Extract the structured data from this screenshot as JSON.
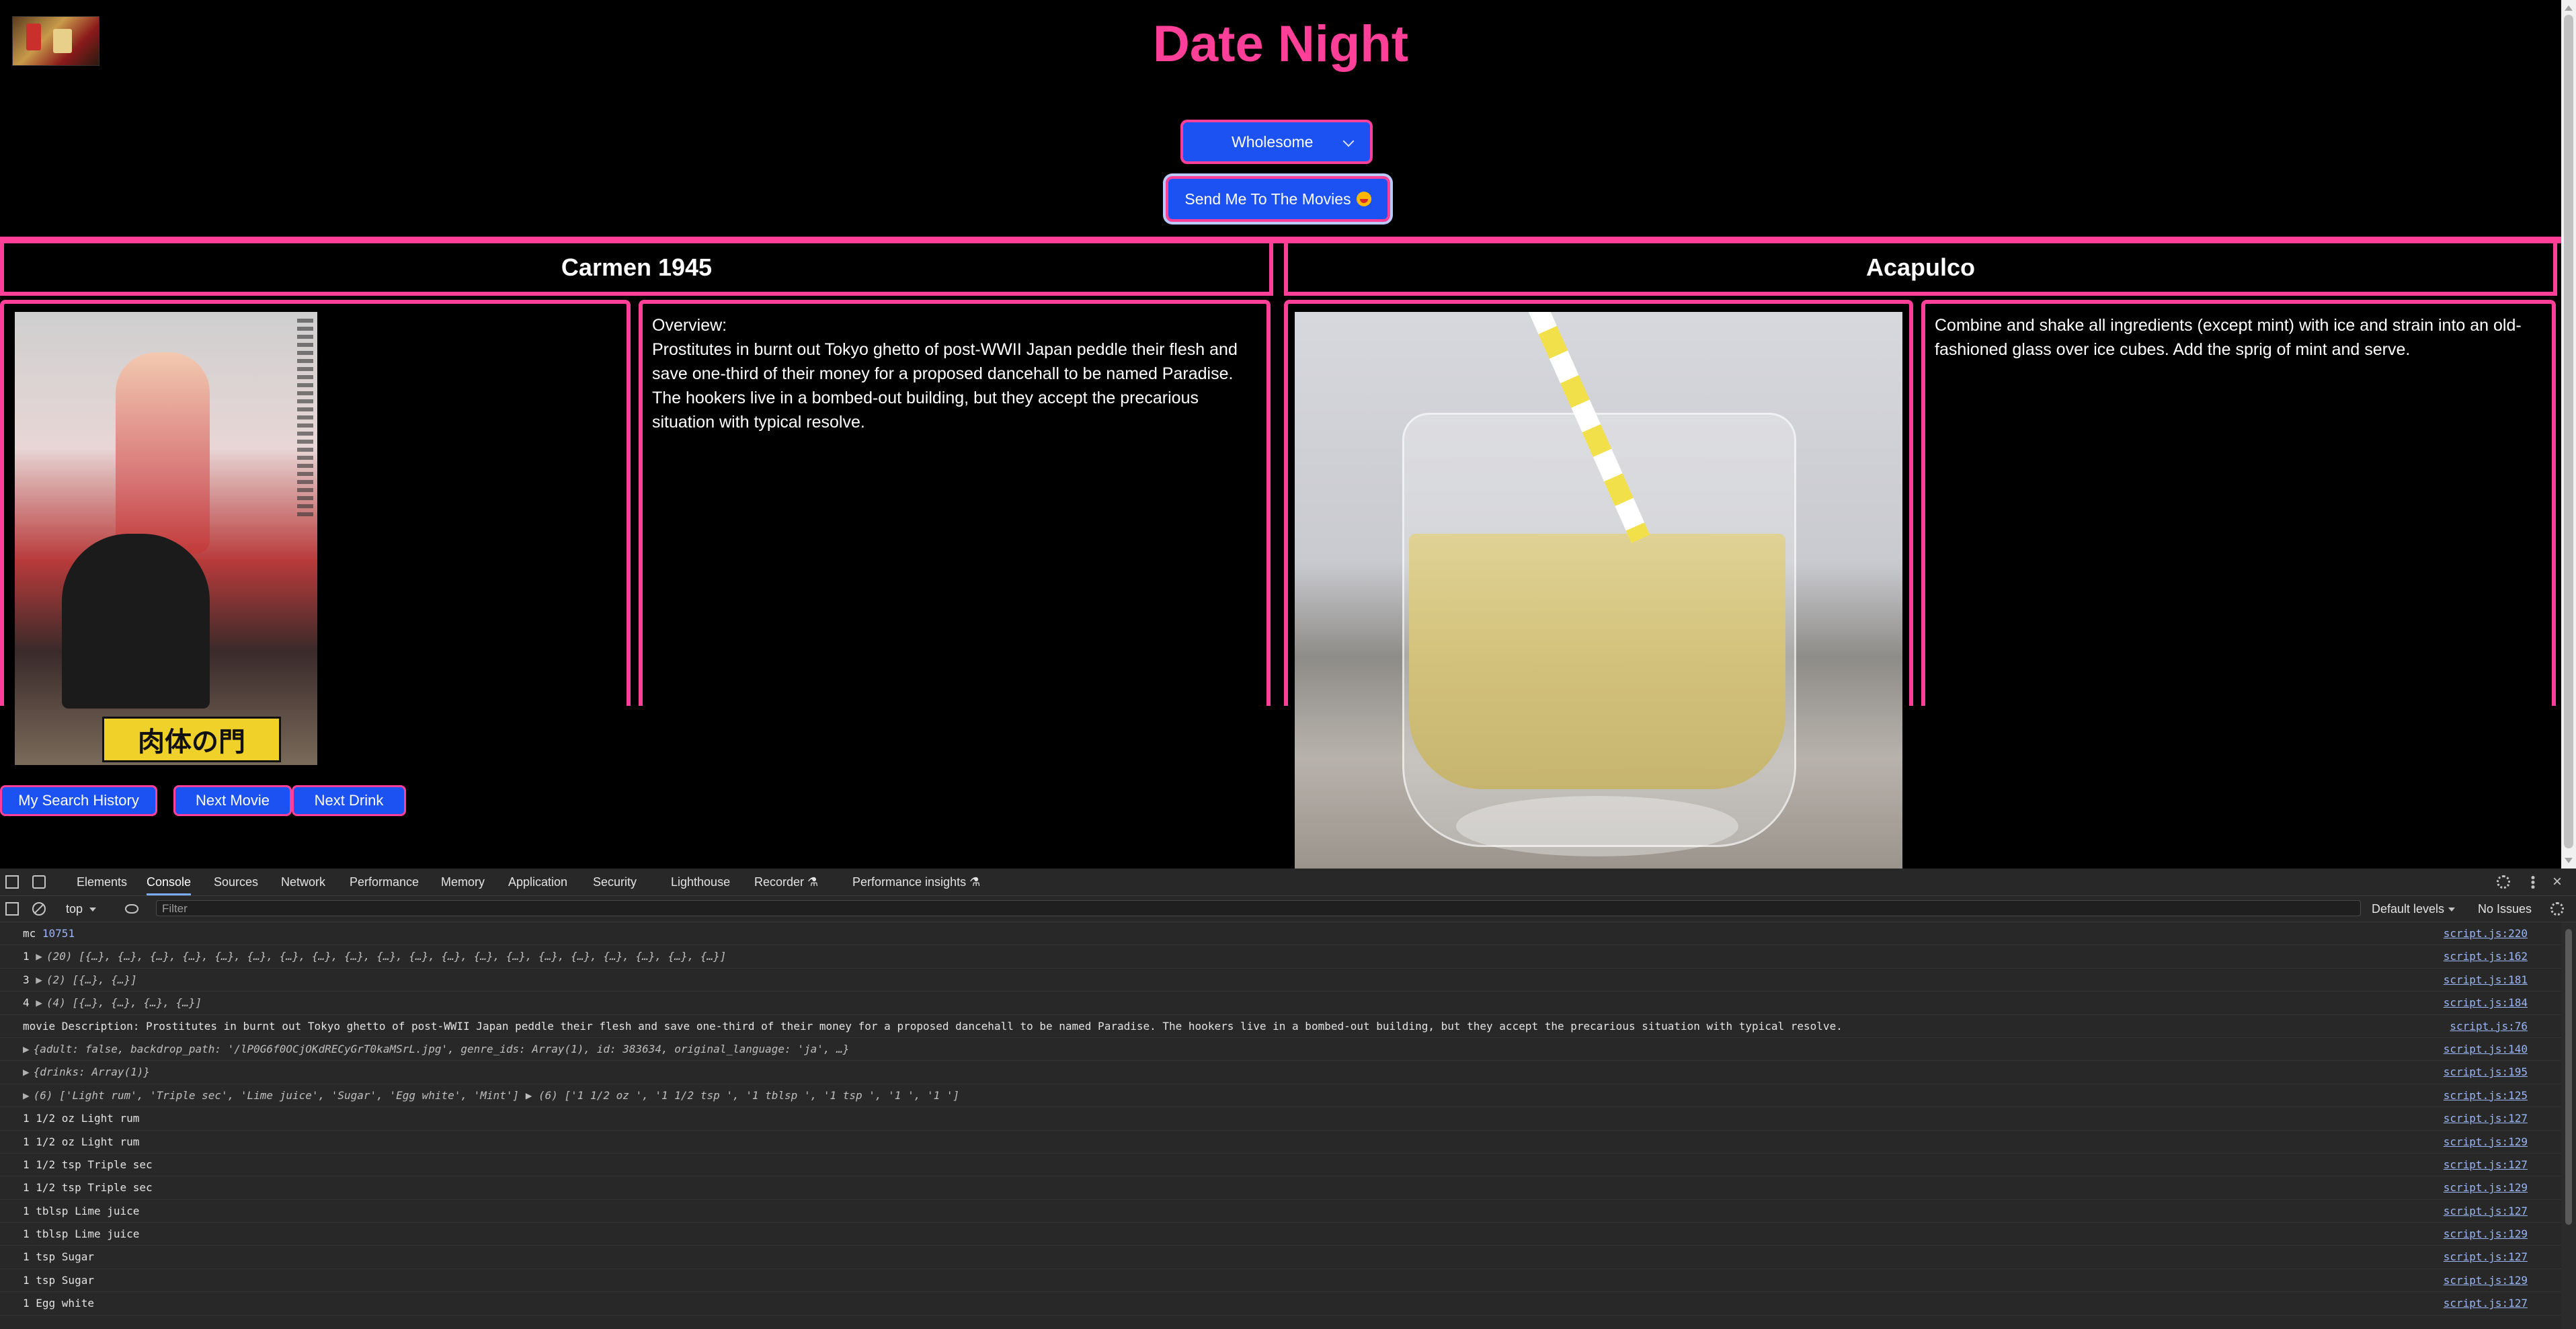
{
  "page": {
    "title": "Date Night",
    "mood_select": "Wholesome",
    "send_button": "Send Me To The Movies",
    "movie": {
      "title": "Carmen 1945",
      "overview_label": "Overview:",
      "overview": "Prostitutes in burnt out Tokyo ghetto of post-WWII Japan peddle their flesh and save one-third of their money for a proposed dancehall to be named Paradise. The hookers live in a bombed-out building, but they accept the precarious situation with typical resolve.",
      "poster_text": "肉体の門"
    },
    "drink": {
      "title": "Acapulco",
      "instructions": "Combine and shake all ingredients (except mint) with ice and strain into an old-fashioned glass over ice cubes. Add the sprig of mint and serve."
    },
    "buttons": {
      "history": "My Search History",
      "next_movie": "Next Movie",
      "next_drink": "Next Drink"
    }
  },
  "devtools": {
    "tabs": [
      "Elements",
      "Console",
      "Sources",
      "Network",
      "Performance",
      "Memory",
      "Application",
      "Security",
      "Lighthouse",
      "Recorder ⚗",
      "Performance insights ⚗"
    ],
    "active_tab": "Console",
    "context": "top",
    "filter_placeholder": "Filter",
    "levels": "Default levels",
    "issues": "No Issues",
    "logs": [
      {
        "prefix": "mc",
        "text": "10751",
        "source": "script.js:220"
      },
      {
        "prefix": "1",
        "text": "(20) [{…}, {…}, {…}, {…}, {…}, {…}, {…}, {…}, {…}, {…}, {…}, {…}, {…}, {…}, {…}, {…}, {…}, {…}, {…}, {…}]",
        "source": "script.js:162"
      },
      {
        "prefix": "3",
        "text": "(2) [{…}, {…}]",
        "source": "script.js:181"
      },
      {
        "prefix": "4",
        "text": "(4) [{…}, {…}, {…}, {…}]",
        "source": "script.js:184"
      },
      {
        "prefix": "movie Description:",
        "text": "Prostitutes in burnt out Tokyo ghetto of post-WWII Japan peddle their flesh and save one-third of their money for a proposed dancehall to be named Paradise. The hookers live in a bombed-out building, but they accept the precarious situation with typical resolve.",
        "source": "script.js:76"
      },
      {
        "prefix": "",
        "text": "{adult: false, backdrop_path: '/lP0G6f0OCjOKdRECyGrT0kaMSrL.jpg', genre_ids: Array(1), id: 383634, original_language: 'ja', …}",
        "source": "script.js:140"
      },
      {
        "prefix": "",
        "text": "{drinks: Array(1)}",
        "source": "script.js:195"
      },
      {
        "prefix": "",
        "text": "(6) ['Light rum', 'Triple sec', 'Lime juice', 'Sugar', 'Egg white', 'Mint'] ▶ (6) ['1 1/2 oz ', '1 1/2 tsp ', '1 tblsp ', '1 tsp ', '1 ', '1 ']",
        "source": "script.js:125"
      },
      {
        "prefix": "",
        "text": "1 1/2 oz  Light rum",
        "source": "script.js:127"
      },
      {
        "prefix": "",
        "text": "1 1/2 oz  Light rum",
        "source": "script.js:129"
      },
      {
        "prefix": "",
        "text": "1 1/2 tsp  Triple sec",
        "source": "script.js:127"
      },
      {
        "prefix": "",
        "text": "1 1/2 tsp  Triple sec",
        "source": "script.js:129"
      },
      {
        "prefix": "",
        "text": "1 tblsp  Lime juice",
        "source": "script.js:127"
      },
      {
        "prefix": "",
        "text": "1 tblsp  Lime juice",
        "source": "script.js:129"
      },
      {
        "prefix": "",
        "text": "1 tsp  Sugar",
        "source": "script.js:127"
      },
      {
        "prefix": "",
        "text": "1 tsp  Sugar",
        "source": "script.js:129"
      },
      {
        "prefix": "",
        "text": "1  Egg white",
        "source": "script.js:127"
      }
    ]
  },
  "colors": {
    "accent_pink": "#ff3f98",
    "button_blue": "#1c52f2",
    "devtools_bg": "#282828"
  }
}
